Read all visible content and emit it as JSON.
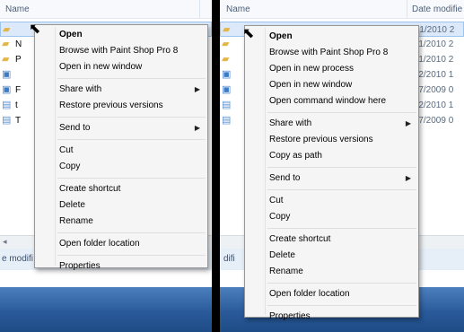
{
  "left": {
    "header": {
      "name_label": "Name"
    },
    "files": [
      {
        "icon": "folder-icon",
        "name": ""
      },
      {
        "icon": "folder-icon",
        "name": "N"
      },
      {
        "icon": "folder-icon",
        "name": "P"
      },
      {
        "icon": "image-file-icon",
        "name": ""
      },
      {
        "icon": "image-file-icon",
        "name": "F"
      },
      {
        "icon": "text-file-icon",
        "name": "t"
      },
      {
        "icon": "text-file-icon",
        "name": "T"
      }
    ],
    "status_text": "e modifi",
    "context_menu": {
      "items": [
        {
          "label": "Open",
          "bold": true
        },
        {
          "label": "Browse with Paint Shop Pro 8"
        },
        {
          "label": "Open in new window"
        },
        {
          "sep": true
        },
        {
          "label": "Share with",
          "submenu": true
        },
        {
          "label": "Restore previous versions"
        },
        {
          "sep": true
        },
        {
          "label": "Send to",
          "submenu": true
        },
        {
          "sep": true
        },
        {
          "label": "Cut"
        },
        {
          "label": "Copy"
        },
        {
          "sep": true
        },
        {
          "label": "Create shortcut"
        },
        {
          "label": "Delete"
        },
        {
          "label": "Rename"
        },
        {
          "sep": true
        },
        {
          "label": "Open folder location"
        },
        {
          "sep": true
        },
        {
          "label": "Properties"
        }
      ]
    }
  },
  "right": {
    "header": {
      "name_label": "Name",
      "date_label": "Date modifie"
    },
    "files": [
      {
        "icon": "folder-icon",
        "name": "",
        "date": "/01/2010 2"
      },
      {
        "icon": "folder-icon",
        "name": "",
        "date": "/01/2010 2"
      },
      {
        "icon": "folder-icon",
        "name": "",
        "date": "/01/2010 2"
      },
      {
        "icon": "image-file-icon",
        "name": "",
        "date": "/02/2010 1"
      },
      {
        "icon": "image-file-icon",
        "name": "",
        "date": "/07/2009 0"
      },
      {
        "icon": "text-file-icon",
        "name": "",
        "date": "/02/2010 1"
      },
      {
        "icon": "text-file-icon",
        "name": "",
        "date": "/07/2009 0"
      }
    ],
    "status_text": "difi",
    "context_menu": {
      "items": [
        {
          "label": "Open",
          "bold": true
        },
        {
          "label": "Browse with Paint Shop Pro 8"
        },
        {
          "label": "Open in new process"
        },
        {
          "label": "Open in new window"
        },
        {
          "label": "Open command window here"
        },
        {
          "sep": true
        },
        {
          "label": "Share with",
          "submenu": true
        },
        {
          "label": "Restore previous versions"
        },
        {
          "label": "Copy as path"
        },
        {
          "sep": true
        },
        {
          "label": "Send to",
          "submenu": true
        },
        {
          "sep": true
        },
        {
          "label": "Cut"
        },
        {
          "label": "Copy"
        },
        {
          "sep": true
        },
        {
          "label": "Create shortcut"
        },
        {
          "label": "Delete"
        },
        {
          "label": "Rename"
        },
        {
          "sep": true
        },
        {
          "label": "Open folder location"
        },
        {
          "sep": true
        },
        {
          "label": "Properties"
        }
      ]
    }
  },
  "colors": {
    "taskbar": "#2a5a9a",
    "menu_bg": "#f5f5f5",
    "selection": "#dbe9fb",
    "header_text": "#4c607a"
  }
}
